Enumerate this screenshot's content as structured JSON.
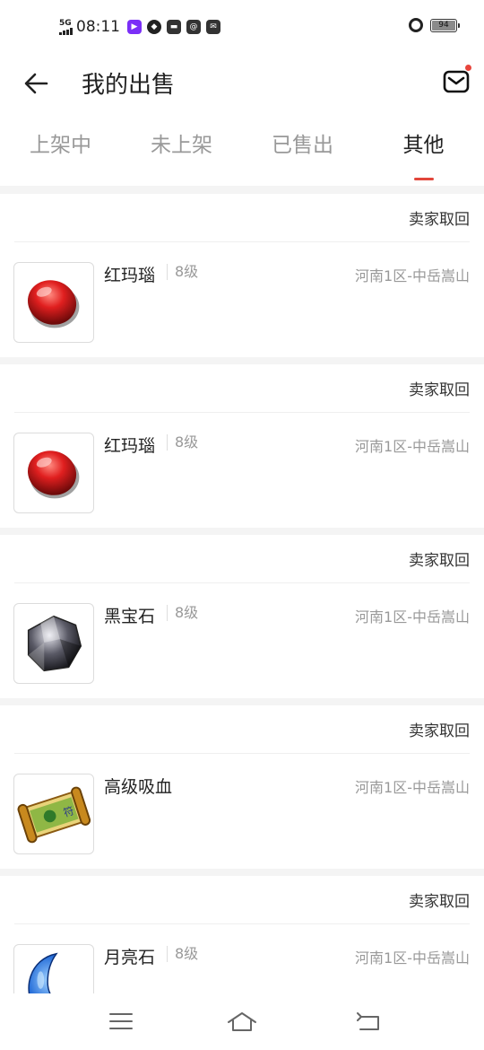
{
  "status_bar": {
    "network": "5G",
    "time": "08:11",
    "battery": "94",
    "battery_level": 0.94
  },
  "header": {
    "title": "我的出售",
    "back_icon": "arrow-left-icon",
    "mail_icon": "mail-icon",
    "has_unread_dot": true
  },
  "tabs": [
    {
      "label": "上架中",
      "active": false
    },
    {
      "label": "未上架",
      "active": false
    },
    {
      "label": "已售出",
      "active": false
    },
    {
      "label": "其他",
      "active": true
    }
  ],
  "accent_color": "#e2463b",
  "orders": [
    {
      "status": "卖家取回",
      "name": "红玛瑙",
      "level": "8级",
      "server": "河南1区-中岳嵩山",
      "image": "red-agate-icon"
    },
    {
      "status": "卖家取回",
      "name": "红玛瑙",
      "level": "8级",
      "server": "河南1区-中岳嵩山",
      "image": "red-agate-icon"
    },
    {
      "status": "卖家取回",
      "name": "黑宝石",
      "level": "8级",
      "server": "河南1区-中岳嵩山",
      "image": "black-gem-icon"
    },
    {
      "status": "卖家取回",
      "name": "高级吸血",
      "level": "",
      "server": "河南1区-中岳嵩山",
      "image": "scroll-icon"
    },
    {
      "status": "卖家取回",
      "name": "月亮石",
      "level": "8级",
      "server": "河南1区-中岳嵩山",
      "image": "moonstone-icon"
    }
  ],
  "bottom_nav": [
    "menu-icon",
    "home-icon",
    "back-icon"
  ]
}
